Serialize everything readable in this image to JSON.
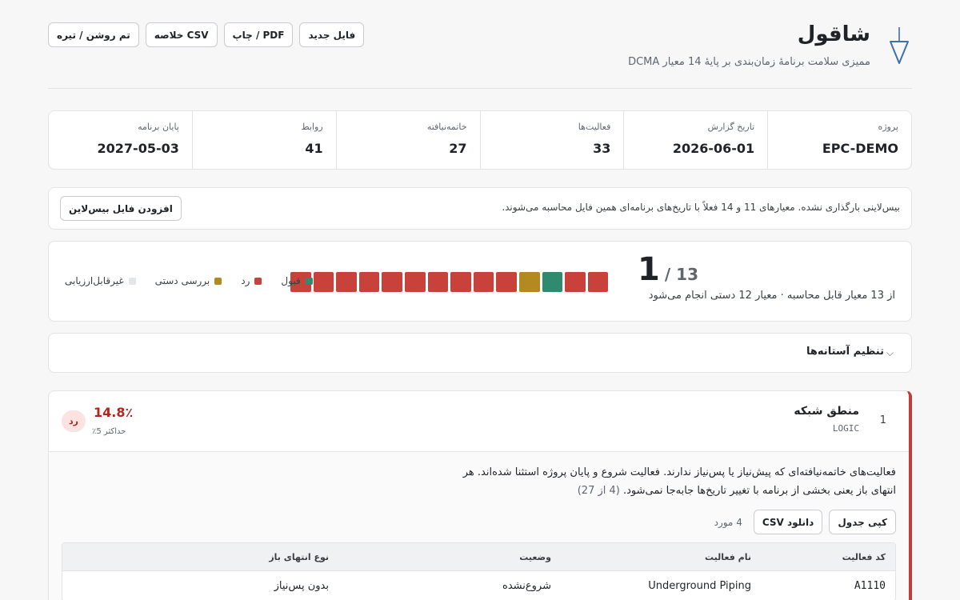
{
  "header": {
    "title": "شاقول",
    "subtitle": "ممیزی سلامت برنامهٔ زمان‌بندی بر پایهٔ 14 معیار DCMA",
    "actions": {
      "theme": "تم روشن / تیره",
      "csv_summary": "خلاصه CSV",
      "print": "چاپ / PDF",
      "new_file": "فایل جدید"
    }
  },
  "stats": [
    {
      "label": "پروژه",
      "value": "EPC-DEMO"
    },
    {
      "label": "تاریخ گزارش",
      "value": "2026-06-01"
    },
    {
      "label": "فعالیت‌ها",
      "value": "33"
    },
    {
      "label": "خاتمه‌نیافته",
      "value": "27"
    },
    {
      "label": "روابط",
      "value": "41"
    },
    {
      "label": "پایان برنامه",
      "value": "2027-05-03"
    }
  ],
  "notice": {
    "text": "بیس‌لاینی بارگذاری نشده. معیارهای 11 و 14 فعلاً با تاریخ‌های برنامه‌ای همین فایل محاسبه می‌شوند.",
    "button": "افزودن فایل بیس‌لاین"
  },
  "score": {
    "passed": "1",
    "total": "/ 13",
    "caption": "از 13 معیار قابل محاسبه · معیار 12 دستی انجام می‌شود",
    "criteria_status": [
      "fail",
      "fail",
      "fail",
      "fail",
      "fail",
      "fail",
      "fail",
      "fail",
      "fail",
      "fail",
      "manual",
      "pass",
      "fail",
      "fail"
    ],
    "colors": {
      "pass": "#2e8b6e",
      "fail": "#c9413b",
      "manual": "#b38a1f",
      "na": "#e3e5e8"
    },
    "legend": [
      {
        "key": "pass",
        "label": "قبول"
      },
      {
        "key": "fail",
        "label": "رد"
      },
      {
        "key": "manual",
        "label": "بررسی دستی"
      },
      {
        "key": "na",
        "label": "غیرقابل‌ارزیابی"
      }
    ]
  },
  "thresholds": {
    "label": "تنظیم آستانه‌ها",
    "icon": "chevron-down-icon"
  },
  "criterion": {
    "number": "1",
    "title": "منطق شبکه",
    "code": "LOGIC",
    "value": "14.8٪",
    "limit": "حداکثر 5٪",
    "verdict": "رد",
    "description": "فعالیت‌های خاتمه‌نیافته‌ای که پیش‌نیاز یا پس‌نیاز ندارند. فعالیت شروع و پایان پروژه استثنا شده‌اند. هر انتهای باز یعنی بخشی از برنامه با تغییر تاریخ‌ها جابه‌جا نمی‌شود.",
    "fraction": "(4 از 27)",
    "copy_button": "کپی جدول",
    "csv_button": "دانلود CSV",
    "count": "4 مورد",
    "columns": [
      "کد فعالیت",
      "نام فعالیت",
      "وضعیت",
      "نوع انتهای باز"
    ],
    "rows": [
      {
        "code": "A1110",
        "name": "Underground Piping",
        "status": "شروع‌نشده",
        "type": "بدون پس‌نیاز"
      }
    ]
  }
}
